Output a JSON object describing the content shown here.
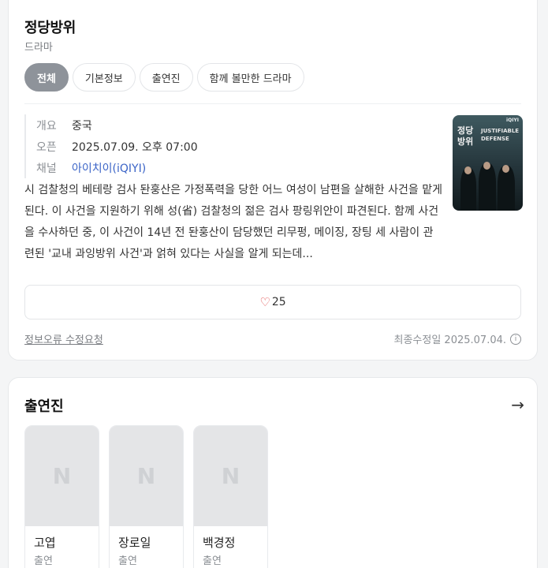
{
  "drama": {
    "title": "정당방위",
    "category": "드라마"
  },
  "tabs": [
    {
      "label": "전체",
      "active": true
    },
    {
      "label": "기본정보",
      "active": false
    },
    {
      "label": "출연진",
      "active": false
    },
    {
      "label": "함께 볼만한 드라마",
      "active": false
    }
  ],
  "meta": [
    {
      "key": "개요",
      "value": "중국"
    },
    {
      "key": "오픈",
      "value": "2025.07.09. 오후 07:00"
    },
    {
      "key": "채널",
      "value": "아이치이(iQIYI)"
    }
  ],
  "poster": {
    "title_line1": "정당",
    "title_line2": "방위",
    "en_line1": "JUSTIFIABLE",
    "en_line2": "DEFENSE",
    "brand": "iQIYI"
  },
  "synopsis": "시 검찰청의 베테랑 검사 돤훙산은 가정폭력을 당한 어느 여성이 남편을 살해한 사건을 맡게 된다. 이 사건을 지원하기 위해 성(省) 검찰청의 젊은 검사 팡링위안이 파견된다. 함께 사건을 수사하던 중, 이 사건이 14년 전 돤훙산이 담당했던 리무펑, 메이징, 장팅 세 사람이 관련된 '교내 과잉방위 사건'과 얽혀 있다는 사실을 알게 되는데...",
  "likes": {
    "icon": "heart-icon",
    "count": "25"
  },
  "footer": {
    "report_link": "정보오류 수정요청",
    "updated": "최종수정일 2025.07.04."
  },
  "cast_section": {
    "title": "출연진",
    "members": [
      {
        "name": "고엽",
        "role": "출연",
        "placeholder": "N"
      },
      {
        "name": "장로일",
        "role": "출연",
        "placeholder": "N"
      },
      {
        "name": "백경정",
        "role": "출연",
        "placeholder": "N"
      }
    ]
  },
  "colors": {
    "active_tab": "#8e939a",
    "link": "#3b64c7",
    "heart": "#e04848"
  }
}
